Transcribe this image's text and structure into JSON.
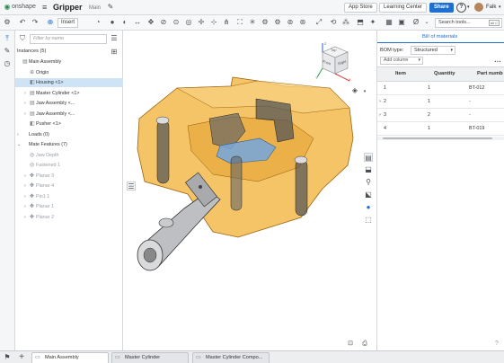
{
  "app": {
    "logo": "onshape",
    "doc_title": "Gripper",
    "branch": "Main"
  },
  "top_right": {
    "app_store": "App Store",
    "learning": "Learning Center",
    "share": "Share",
    "help": "?",
    "user": "Falk"
  },
  "toolbar": {
    "insert": "Insert",
    "search_tools": "Search tools...",
    "shortcut": "alt C"
  },
  "filter": {
    "placeholder": "Filter by name"
  },
  "instances_header": "Instances (5)",
  "tree": [
    {
      "label": "Main Assembly",
      "indent": 0,
      "caret": "",
      "icon": "▤",
      "dim": false,
      "selected": false
    },
    {
      "label": "Origin",
      "indent": 1,
      "caret": "",
      "icon": "⊕",
      "dim": false,
      "selected": false
    },
    {
      "label": "Housing <1>",
      "indent": 1,
      "caret": "",
      "icon": "◧",
      "dim": false,
      "selected": true
    },
    {
      "label": "Master Cylinder <1>",
      "indent": 1,
      "caret": "›",
      "icon": "▤",
      "dim": false,
      "selected": false
    },
    {
      "label": "Jaw Assembly <...",
      "indent": 1,
      "caret": "›",
      "icon": "▤",
      "dim": false,
      "selected": false
    },
    {
      "label": "Jaw Assembly <...",
      "indent": 1,
      "caret": "›",
      "icon": "▤",
      "dim": false,
      "selected": false
    },
    {
      "label": "Pusher <1>",
      "indent": 1,
      "caret": "",
      "icon": "◧",
      "dim": false,
      "selected": false
    },
    {
      "label": "Loads (0)",
      "indent": 0,
      "caret": "›",
      "icon": "",
      "dim": false,
      "selected": false
    },
    {
      "label": "Mate Features (7)",
      "indent": 0,
      "caret": "⌄",
      "icon": "",
      "dim": false,
      "selected": false
    },
    {
      "label": "Jaw Depth",
      "indent": 1,
      "caret": "",
      "icon": "◎",
      "dim": true,
      "selected": false
    },
    {
      "label": "Fastened 1",
      "indent": 1,
      "caret": "",
      "icon": "◎",
      "dim": true,
      "selected": false
    },
    {
      "label": "Planar 3",
      "indent": 1,
      "caret": "›",
      "icon": "✥",
      "dim": true,
      "selected": false
    },
    {
      "label": "Planar 4",
      "indent": 1,
      "caret": "›",
      "icon": "✥",
      "dim": true,
      "selected": false
    },
    {
      "label": "Pin1 1",
      "indent": 1,
      "caret": "›",
      "icon": "✥",
      "dim": true,
      "selected": false
    },
    {
      "label": "Planar 1",
      "indent": 1,
      "caret": "›",
      "icon": "✥",
      "dim": true,
      "selected": false
    },
    {
      "label": "Planar 2",
      "indent": 1,
      "caret": "›",
      "icon": "✥",
      "dim": true,
      "selected": false
    }
  ],
  "viewcube": {
    "top": "Top",
    "front": "Front",
    "right": "Right",
    "x": "X",
    "y": "Y",
    "z": "Z"
  },
  "bom": {
    "title": "Bill of materials",
    "type_label": "BOM type:",
    "type_value": "Structured",
    "add_column": "Add column",
    "columns": [
      "Item",
      "Quantity",
      "Part numb"
    ],
    "rows": [
      {
        "item": "1",
        "qty": "1",
        "part": "BT-012",
        "expand": ""
      },
      {
        "item": "2",
        "qty": "1",
        "part": "-",
        "expand": "›"
      },
      {
        "item": "3",
        "qty": "2",
        "part": "-",
        "expand": "›"
      },
      {
        "item": "4",
        "qty": "1",
        "part": "BT-019",
        "expand": ""
      }
    ]
  },
  "tabs": [
    {
      "label": "Main Assembly",
      "active": true
    },
    {
      "label": "Master Cylinder",
      "active": false
    },
    {
      "label": "Master Cylinder Compo...",
      "active": false
    }
  ],
  "colors": {
    "accent": "#1f6fd1",
    "housing": "#f2b43b",
    "select": "#cfe3f7"
  }
}
